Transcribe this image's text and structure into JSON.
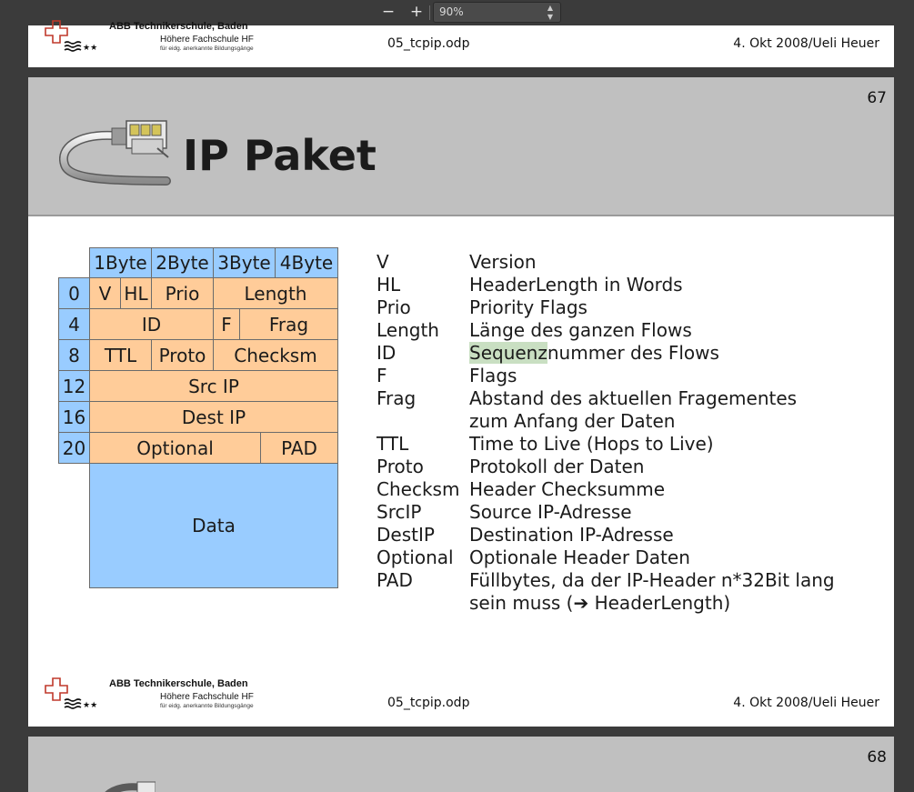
{
  "toolbar": {
    "zoom_out": "−",
    "zoom_in": "+",
    "zoom_value": "90%"
  },
  "footer": {
    "school_name": "ABB Technikerschule, Baden",
    "school_sub": "Höhere Fachschule HF",
    "school_sub2": "für eidg. anerkannte Bildungsgänge",
    "file": "05_tcpip.odp",
    "date_author": "4. Okt 2008/Ueli Heuer"
  },
  "slide": {
    "number": "67",
    "title": "IP Paket",
    "header_row": [
      "1Byte",
      "2Byte",
      "3Byte",
      "4Byte"
    ],
    "offsets": [
      "0",
      "4",
      "8",
      "12",
      "16",
      "20"
    ],
    "fields": {
      "v": "V",
      "hl": "HL",
      "prio": "Prio",
      "length": "Length",
      "id": "ID",
      "f": "F",
      "frag": "Frag",
      "ttl": "TTL",
      "proto": "Proto",
      "checksm": "Checksm",
      "src_ip": "Src IP",
      "dest_ip": "Dest IP",
      "optional": "Optional",
      "pad": "PAD",
      "data": "Data"
    },
    "legend": [
      {
        "abbr": "V",
        "desc": "Version"
      },
      {
        "abbr": "HL",
        "desc": "HeaderLength in Words"
      },
      {
        "abbr": "Prio",
        "desc": "Priority Flags"
      },
      {
        "abbr": "Length",
        "desc": "Länge des ganzen Flows"
      },
      {
        "abbr": "ID",
        "desc_hl": "Sequenz",
        "desc_rest": "nummer des Flows"
      },
      {
        "abbr": "F",
        "desc": "Flags"
      },
      {
        "abbr": "Frag",
        "desc": "Abstand des aktuellen Fragementes"
      },
      {
        "abbr": "",
        "desc": "zum Anfang der Daten"
      },
      {
        "abbr": "TTL",
        "desc": "Time to Live (Hops to Live)"
      },
      {
        "abbr": "Proto",
        "desc": "Protokoll der Daten"
      },
      {
        "abbr": "Checksm",
        "desc": "Header Checksumme"
      },
      {
        "abbr": "SrcIP",
        "desc": "Source IP-Adresse"
      },
      {
        "abbr": "DestIP",
        "desc": "Destination IP-Adresse"
      },
      {
        "abbr": "Optional",
        "desc": "Optionale Header Daten"
      },
      {
        "abbr": "PAD",
        "desc": "Füllbytes, da der IP-Header n*32Bit lang"
      },
      {
        "abbr": "",
        "desc": "sein muss (➔ HeaderLength)"
      }
    ]
  },
  "next_slide": {
    "number": "68"
  },
  "colors": {
    "blue_cell": "#99ccff",
    "orange_cell": "#ffcc99",
    "title_band": "#c0c0c0",
    "highlight": "#c9dfc2"
  }
}
